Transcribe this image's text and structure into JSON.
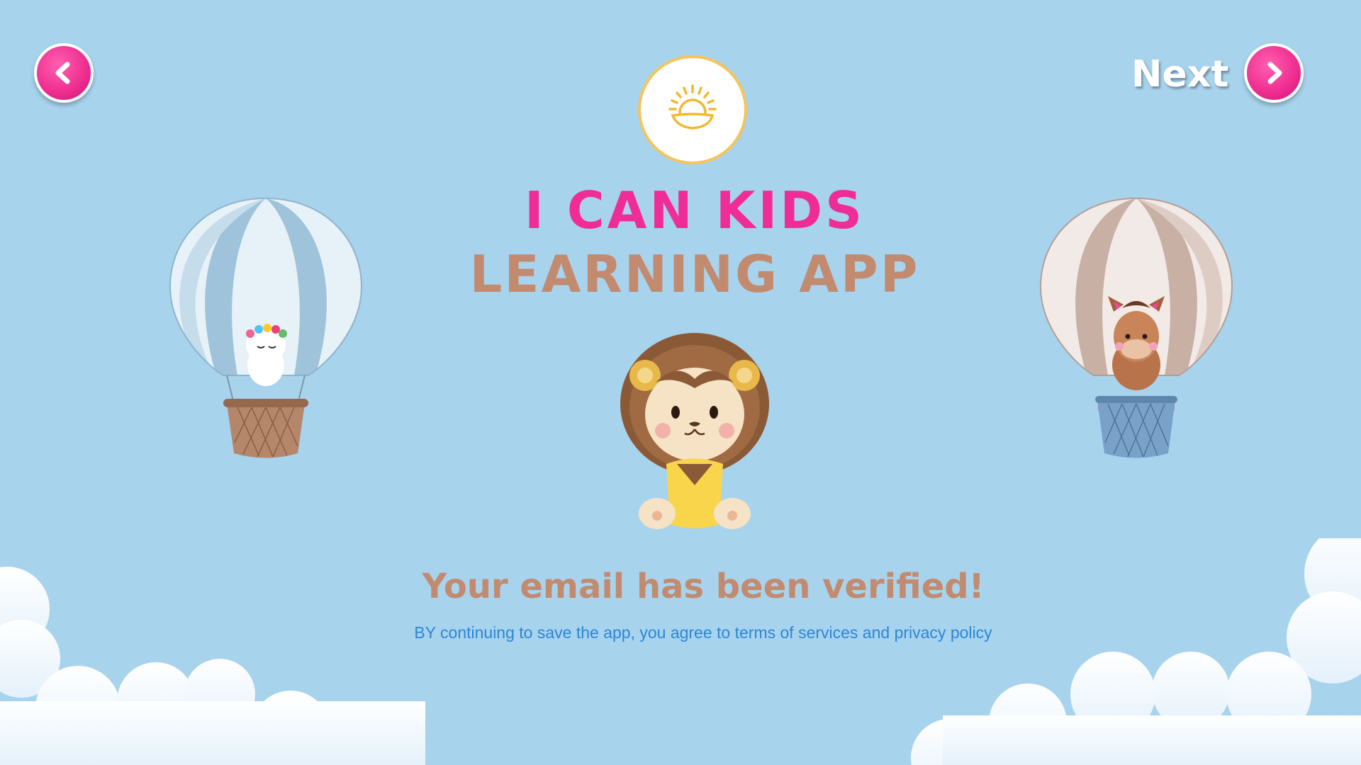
{
  "nav": {
    "back_icon": "chevron-left-icon",
    "next_label": "Next",
    "next_icon": "chevron-right-icon"
  },
  "brand": {
    "logo_icon": "sunrise-icon",
    "title_line1": "I CAN KIDS",
    "title_line2": "LEARNING APP"
  },
  "message": {
    "heading": "Your email has been verified!",
    "terms": "BY continuing to save the app, you agree to terms of services and privacy policy"
  },
  "colors": {
    "background": "#a8d3ed",
    "accent_pink": "#f02c98",
    "brand_brown": "#c28a6e",
    "link_blue": "#2c86d6"
  }
}
